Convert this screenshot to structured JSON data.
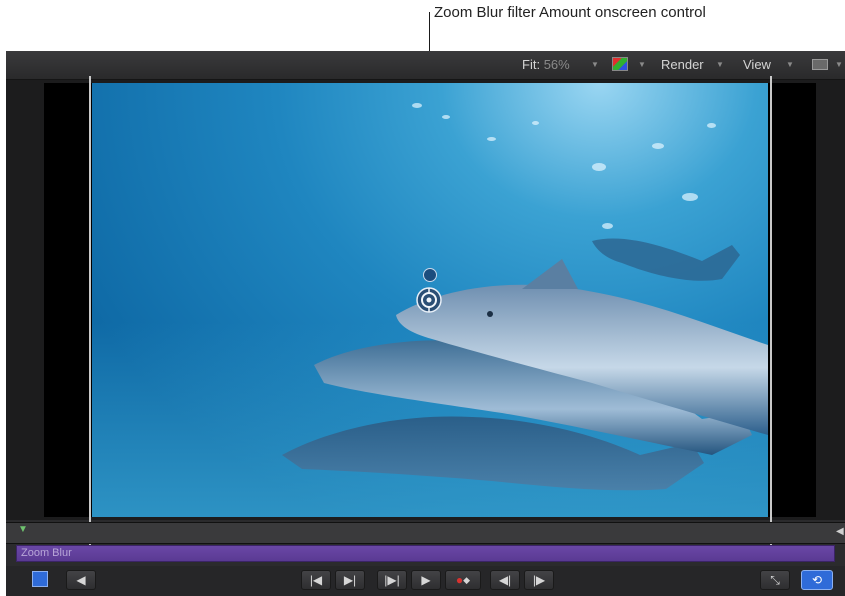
{
  "callout": {
    "label": "Zoom Blur filter Amount onscreen control"
  },
  "toolbar": {
    "fit_label": "Fit:",
    "fit_value": "56%",
    "render_label": "Render",
    "view_label": "View"
  },
  "timeline": {
    "clip_label": "Zoom Blur",
    "clip_color": "#5a3a93",
    "playhead_color": "#6fc36f"
  },
  "icons": {
    "color_channels": "color-channels-icon",
    "layout": "layout-icon",
    "go_to_start": "go-to-start-icon",
    "go_to_end": "go-to-end-icon",
    "play": "play-icon",
    "record": "record-icon",
    "fullscreen": "fullscreen-icon",
    "loop": "loop-icon"
  },
  "accent_color": "#2f6bd8"
}
